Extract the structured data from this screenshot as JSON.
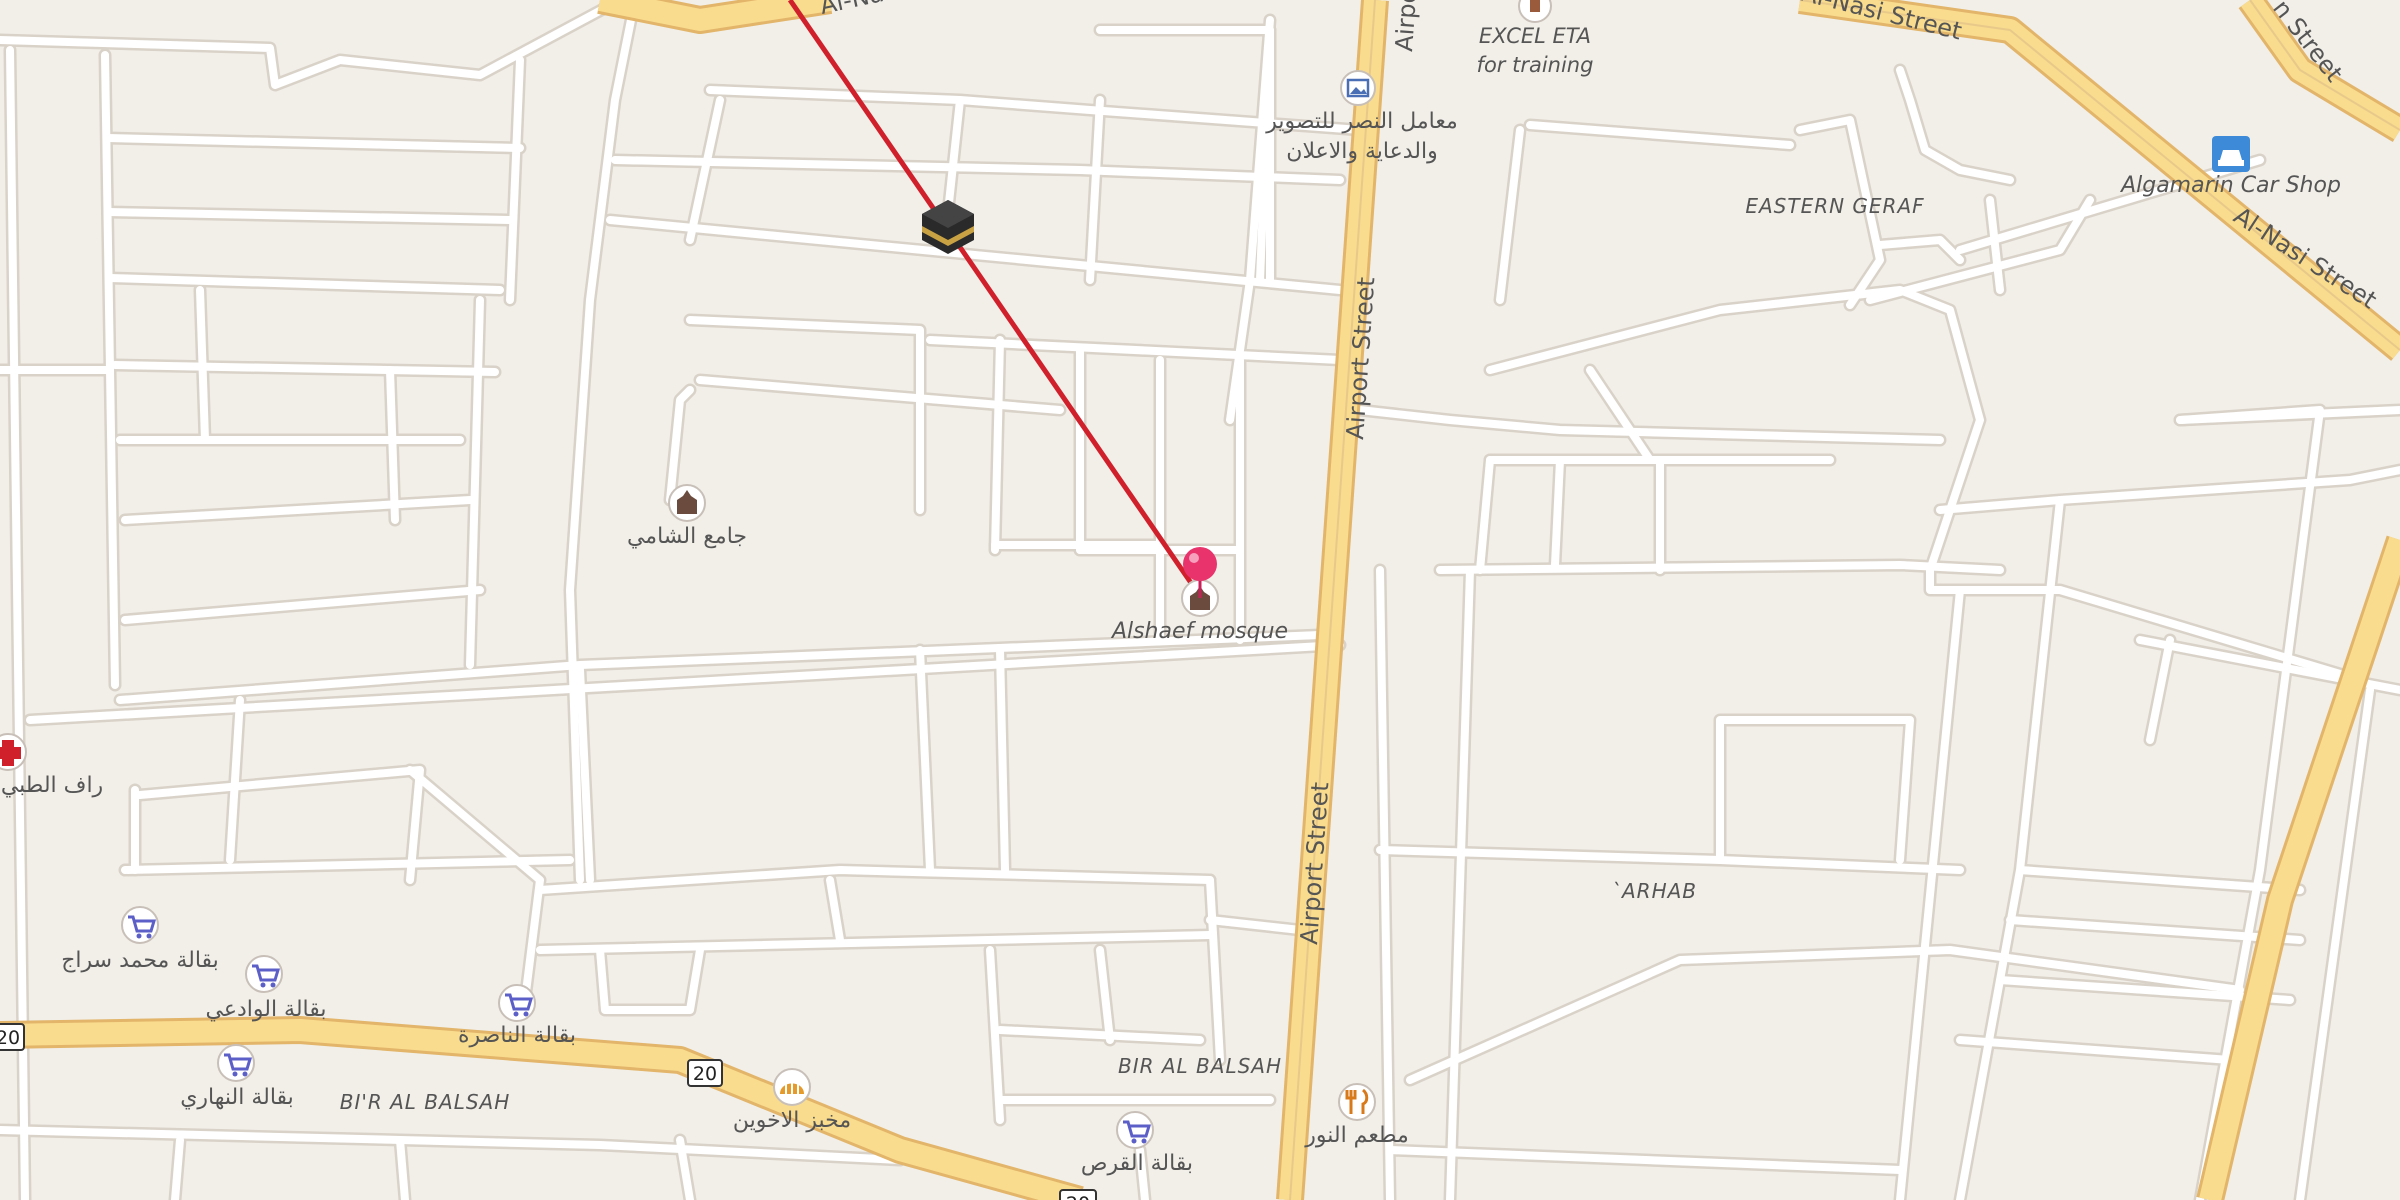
{
  "map": {
    "streets": {
      "airport_1": "Airport Street",
      "airport_2": "Airport Street",
      "airport_3": "Airpo",
      "alnasi_1": "Al-Nasi Street",
      "alnasi_2": "Al-Nasi Street",
      "alnasi_top": "Al-Nasi",
      "street_tr": "n Street"
    },
    "shields": [
      "20",
      "20",
      "20"
    ],
    "areas": {
      "eastern_geraf": "EASTERN GERAF",
      "arhab": "`ARHAB",
      "bir_al_balsah": "BIR AL BALSAH",
      "bir_al_balsah_2": "BI'R AL BALSAH"
    },
    "pois": {
      "alshaef_mosque": "Alshaef mosque",
      "jame_alshami": "جامع الشامي",
      "excel_eta_1": "EXCEL ETA",
      "excel_eta_2": "for training",
      "photo_studio_1": "معامل النصر للتصوير",
      "photo_studio_2": "والدعاية والاعلان",
      "algamarin": "Algamarin Car Shop",
      "clinic": "راف الطبي",
      "grocery_siraj": "بقالة محمد سراج",
      "grocery_wadi": "بقالة الوادعي",
      "grocery_nasira": "بقالة الناصرة",
      "grocery_nahari": "بقالة النهاري",
      "bakery": "مخبز الاخوين",
      "grocery_qirs": "بقالة القرص",
      "restaurant": "مطعم النور"
    },
    "colors": {
      "background": "#f2efe9",
      "road_casing": "#d6c9ba",
      "major_road": "#f9dc8e",
      "major_road_casing": "#e6b96b",
      "qibla_line": "#d0202c",
      "marker": "#e8336d"
    },
    "icons": {
      "kaaba": "kaaba-icon",
      "mosque": "mosque-icon",
      "location_pin": "location-pin-icon",
      "grocery": "cart-icon",
      "bakery": "bread-icon",
      "restaurant": "fork-knife-icon",
      "car_shop": "car-icon",
      "clinic": "cross-icon",
      "photo": "picture-icon"
    }
  }
}
